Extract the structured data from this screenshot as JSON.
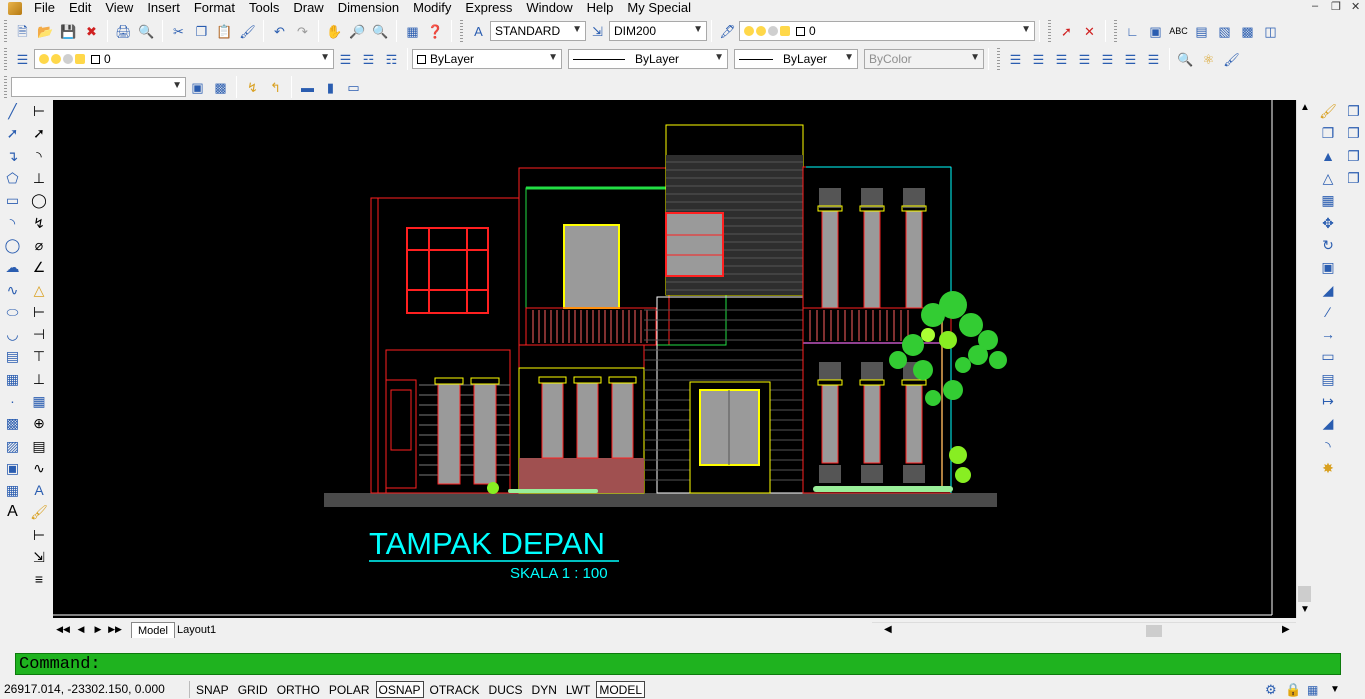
{
  "menubar": {
    "items": [
      "File",
      "Edit",
      "View",
      "Insert",
      "Format",
      "Tools",
      "Draw",
      "Dimension",
      "Modify",
      "Express",
      "Window",
      "Help",
      "My Special"
    ]
  },
  "toolbar_row1": {
    "text_style": "STANDARD",
    "dim_style": "DIM200",
    "layer": "0"
  },
  "toolbar_row2": {
    "layer": "0",
    "color": "ByLayer",
    "linetype": "ByLayer",
    "lineweight": "ByLayer",
    "plot_style": "ByColor"
  },
  "toolbar_row3": {
    "view_combo": ""
  },
  "drawing": {
    "title": "TAMPAK DEPAN",
    "scale": "SKALA 1 : 100",
    "colors": {
      "background": "#000000",
      "title": "#00ffff",
      "red": "#ff2020",
      "yellow": "#ffff00",
      "green": "#22dd44",
      "white": "#ffffff",
      "gray": "#9a9a9a",
      "ground": "#4a4a4a",
      "brick": "#a05050"
    }
  },
  "tabs": {
    "model": "Model",
    "layout1": "Layout1"
  },
  "command": {
    "prompt": "Command:"
  },
  "status": {
    "coords": "26917.014, -23302.150, 0.000",
    "buttons": [
      "SNAP",
      "GRID",
      "ORTHO",
      "POLAR",
      "OSNAP",
      "OTRACK",
      "DUCS",
      "DYN",
      "LWT",
      "MODEL"
    ]
  }
}
